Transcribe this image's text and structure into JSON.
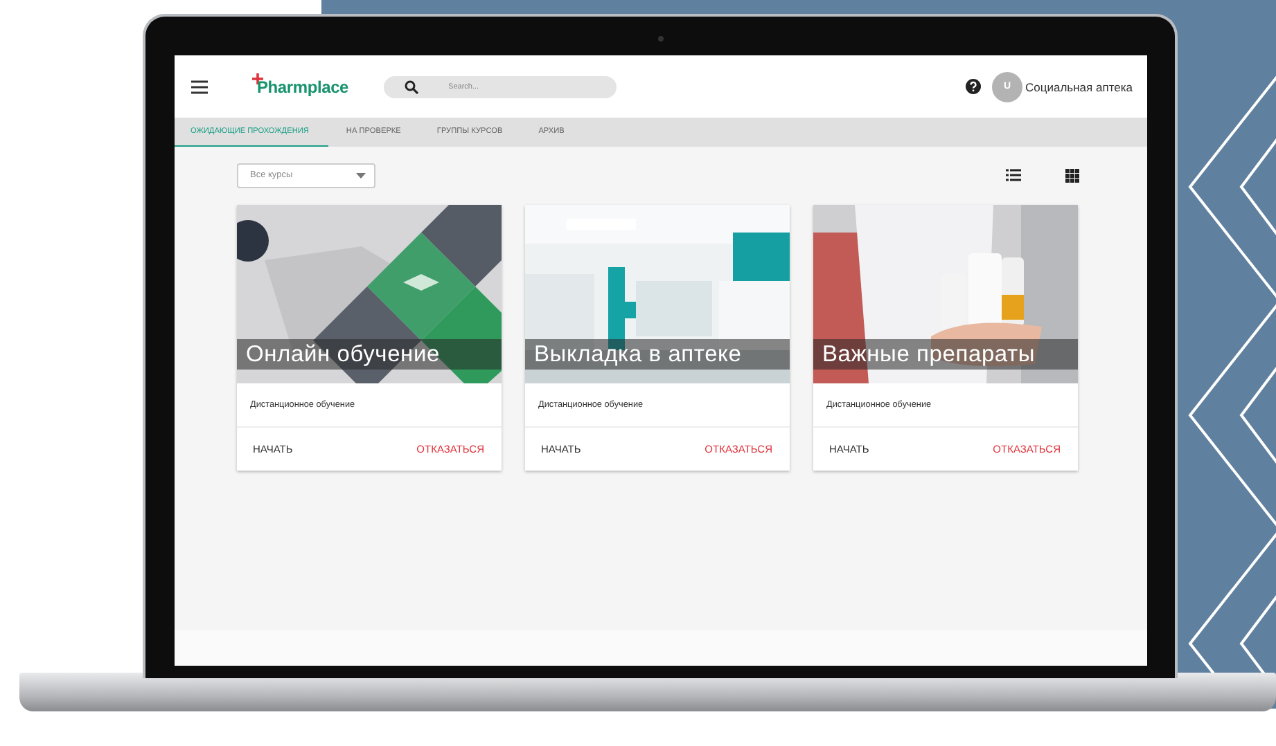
{
  "header": {
    "logo": "Pharmplace",
    "search": {
      "placeholder": "Search..."
    },
    "avatar": "U",
    "user": "Социальная аптека"
  },
  "tabs": [
    {
      "label": "ОЖИДАЮЩИЕ ПРОХОЖДЕНИЯ",
      "selected": true
    },
    {
      "label": "НА ПРОВЕРКЕ",
      "selected": false
    },
    {
      "label": "ГРУППЫ КУРСОВ",
      "selected": false
    },
    {
      "label": "АРХИВ",
      "selected": false
    }
  ],
  "filter": {
    "value": "Все курсы"
  },
  "cards": [
    {
      "title": "Онлайн обучение",
      "subtitle": "Дистанционное обучение",
      "start": "НАЧАТЬ",
      "decline": "ОТКАЗАТЬСЯ"
    },
    {
      "title": "Выкладка в аптеке",
      "subtitle": "Дистанционное обучение",
      "start": "НАЧАТЬ",
      "decline": "ОТКАЗАТЬСЯ"
    },
    {
      "title": "Важные препараты",
      "subtitle": "Дистанционное обучение",
      "start": "НАЧАТЬ",
      "decline": "ОТКАЗАТЬСЯ"
    }
  ]
}
